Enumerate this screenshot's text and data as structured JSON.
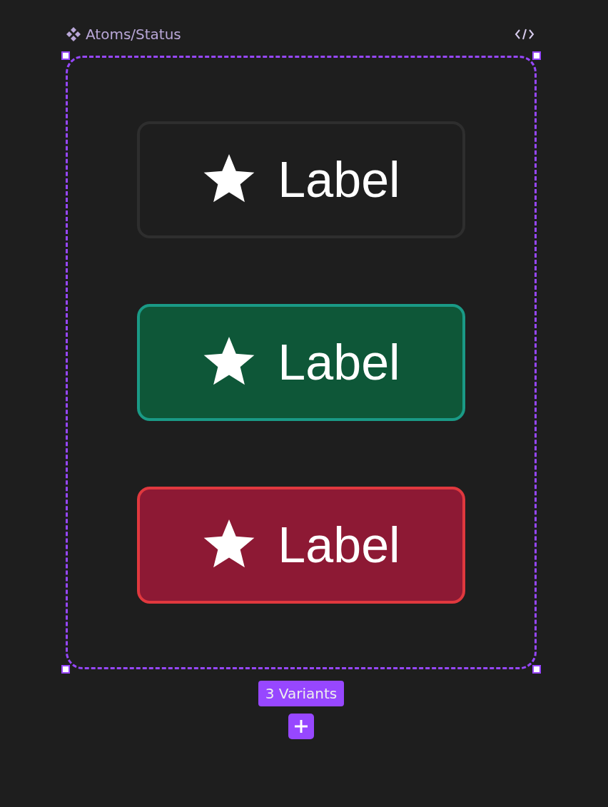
{
  "component_set": {
    "title": "Atoms/Status",
    "variants_badge": "3 Variants"
  },
  "variants": [
    {
      "kind": "neutral",
      "label": "Label"
    },
    {
      "kind": "success",
      "label": "Label"
    },
    {
      "kind": "danger",
      "label": "Label"
    }
  ]
}
